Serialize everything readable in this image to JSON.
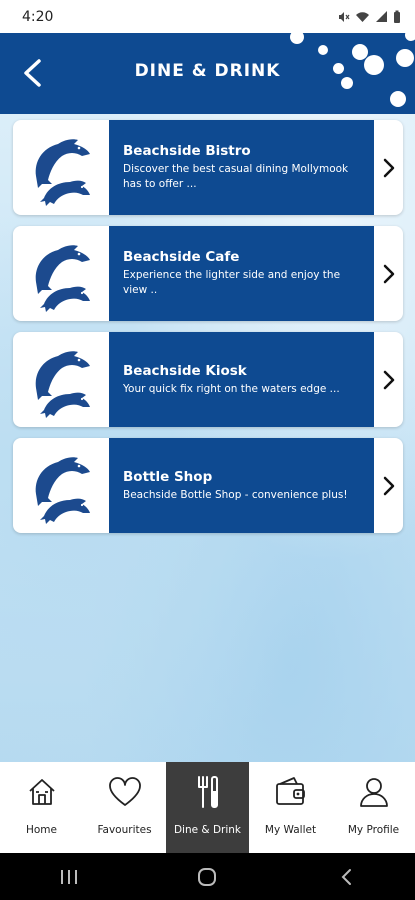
{
  "status_bar": {
    "time": "4:20"
  },
  "header": {
    "title": "DINE & DRINK",
    "accent_color": "#0e4a91"
  },
  "venues": [
    {
      "name": "Beachside Bistro",
      "description": "Discover the best casual dining Mollymook has to offer ..."
    },
    {
      "name": "Beachside Cafe",
      "description": "Experience the lighter side and enjoy the view .."
    },
    {
      "name": "Beachside Kiosk",
      "description": "Your quick fix right on the waters edge ..."
    },
    {
      "name": "Bottle Shop",
      "description": "Beachside Bottle Shop - convenience plus!"
    }
  ],
  "bottom_nav": {
    "items": [
      {
        "label": "Home",
        "icon": "home-icon",
        "active": false
      },
      {
        "label": "Favourites",
        "icon": "heart-icon",
        "active": false
      },
      {
        "label": "Dine & Drink",
        "icon": "dine-drink-icon",
        "active": true
      },
      {
        "label": "My Wallet",
        "icon": "wallet-icon",
        "active": false
      },
      {
        "label": "My Profile",
        "icon": "profile-icon",
        "active": false
      }
    ]
  }
}
